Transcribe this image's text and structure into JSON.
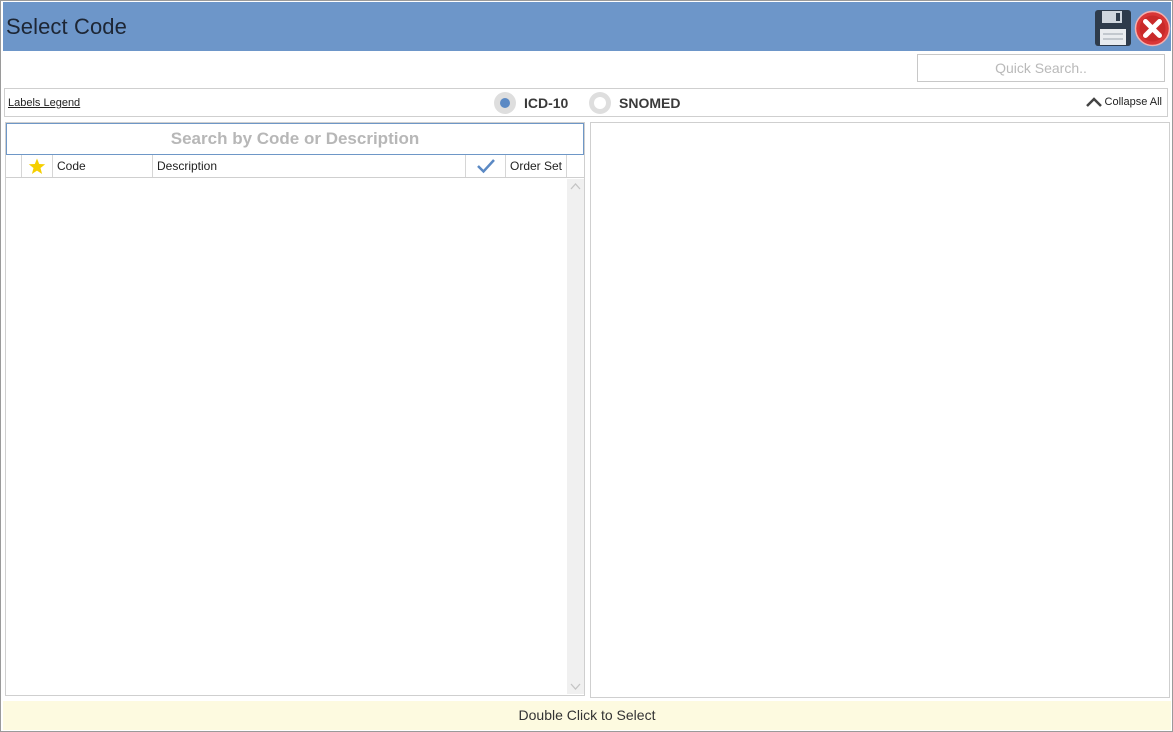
{
  "window": {
    "title": "Select Code"
  },
  "toolbar": {
    "save_icon": "floppy-disk-icon",
    "close_icon": "red-circle-x-icon",
    "quick_search_placeholder": "Quick Search.."
  },
  "legend_row": {
    "labels_legend": "Labels Legend",
    "code_systems": [
      {
        "label": "ICD-10",
        "selected": true
      },
      {
        "label": "SNOMED",
        "selected": false
      }
    ],
    "collapse_all": "Collapse All"
  },
  "code_list": {
    "search_placeholder": "Search by Code or Description",
    "columns": {
      "favorite_icon": "star-icon",
      "code": "Code",
      "description": "Description",
      "selected_icon": "checkmark-icon",
      "order_set": "Order Set"
    },
    "rows": []
  },
  "footer": {
    "hint": "Double Click to Select"
  },
  "colors": {
    "title_bar": "#6d96c9",
    "accent": "#5b89c4",
    "star": "#f5cf00",
    "close_red": "#d93636",
    "footer_bg": "#fdfae0"
  }
}
